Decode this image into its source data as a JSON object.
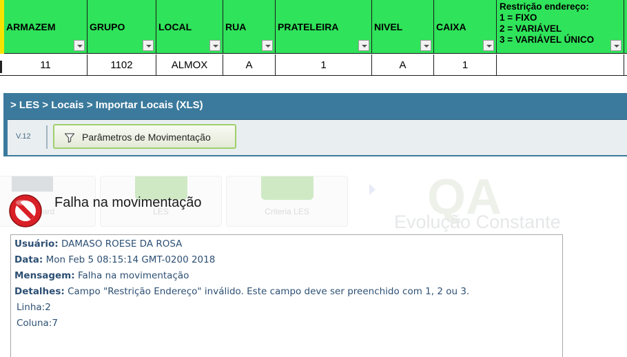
{
  "sheet": {
    "headers": [
      "ARMAZEM",
      "GRUPO",
      "LOCAL",
      "RUA",
      "PRATELEIRA",
      "NIVEL",
      "CAIXA"
    ],
    "restriction_header": "Restrição endereço:\n1 = FIXO\n2 = VARIÁVEL\n3 = VARIÁVEL ÚNICO",
    "row": [
      "11",
      "1102",
      "ALMOX",
      "A",
      "1",
      "A",
      "1",
      ""
    ],
    "colors": {
      "header_bg": "#2fe35a",
      "edge": "#f5e400"
    }
  },
  "les": {
    "breadcrumb": "> LES > Locais > Importar Locais (XLS)",
    "version": "V.12",
    "button_label": "Parâmetros de Movimentação",
    "button_icon": "funnel-icon",
    "colors": {
      "bar": "#3b7a9c",
      "button_border": "#9ed06a"
    }
  },
  "background": {
    "tiles": [
      "...ard",
      "LES",
      "Criteria LES"
    ],
    "logo": "QA",
    "tagline": "Evolução Constante"
  },
  "error": {
    "icon": "no-entry-icon",
    "title": "Falha na movimentação",
    "user_label": "Usuário:",
    "user_value": "DAMASO ROESE DA ROSA",
    "date_label": "Data:",
    "date_value": "Mon Feb 5 08:15:14 GMT-0200 2018",
    "message_label": "Mensagem:",
    "message_value": "Falha na movimentação",
    "details_label": "Detalhes:",
    "details_value": "Campo \"Restrição Endereço\" inválido. Este campo deve ser preenchido com 1, 2 ou 3.",
    "line_text": "Linha:2",
    "column_text": "Coluna:7",
    "colors": {
      "text": "#2c4f73",
      "icon": "#c8171c"
    }
  }
}
